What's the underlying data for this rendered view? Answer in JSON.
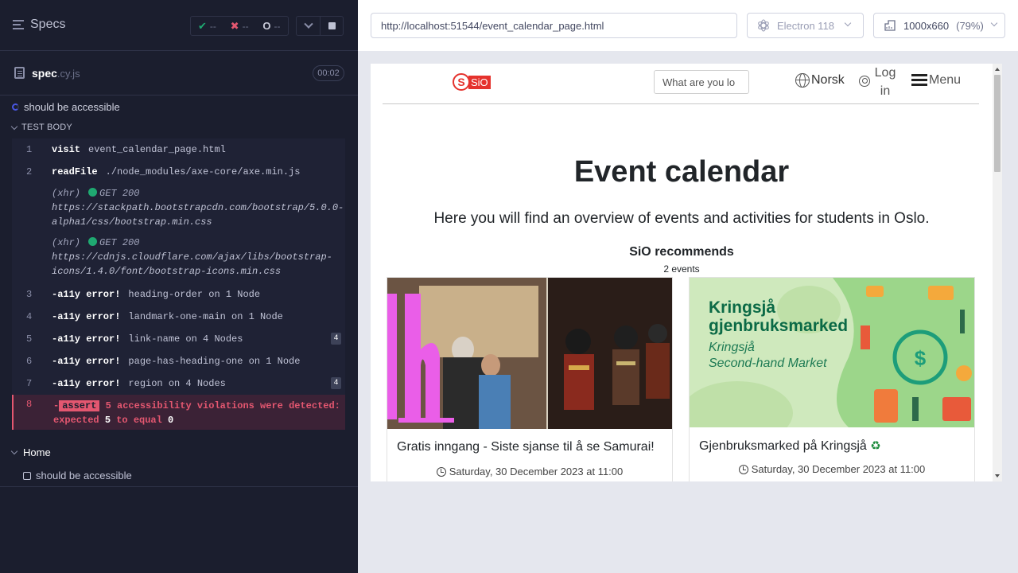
{
  "reporter": {
    "specs_label": "Specs",
    "stats": {
      "passed": "--",
      "failed": "--",
      "pending": "--"
    },
    "spec": {
      "name": "spec",
      "ext": ".cy.js",
      "duration": "00:02"
    },
    "test_title": "should be accessible",
    "body_label": "TEST BODY",
    "commands": [
      {
        "num": "1",
        "name": "visit",
        "msg": "event_calendar_page.html"
      },
      {
        "num": "2",
        "name": "readFile",
        "msg": "./node_modules/axe-core/axe.min.js"
      }
    ],
    "xhr": [
      {
        "label": "(xhr)",
        "status": "GET 200",
        "url_line1": "https://stackpath.bootstrapcdn.com/bootstrap/5.0.0-",
        "url_line2": "alpha1/css/bootstrap.min.css"
      },
      {
        "label": "(xhr)",
        "status": "GET 200",
        "url_line1": "https://cdnjs.cloudflare.com/ajax/libs/bootstrap-",
        "url_line2": "icons/1.4.0/font/bootstrap-icons.min.css"
      }
    ],
    "a11y": [
      {
        "num": "3",
        "name": "-a11y error!",
        "msg": "heading-order on 1 Node",
        "badge": ""
      },
      {
        "num": "4",
        "name": "-a11y error!",
        "msg": "landmark-one-main on 1 Node",
        "badge": ""
      },
      {
        "num": "5",
        "name": "-a11y error!",
        "msg": "link-name on 4 Nodes",
        "badge": "4"
      },
      {
        "num": "6",
        "name": "-a11y error!",
        "msg": "page-has-heading-one on 1 Node",
        "badge": ""
      },
      {
        "num": "7",
        "name": "-a11y error!",
        "msg": "region on 4 Nodes",
        "badge": "4"
      }
    ],
    "assert": {
      "num": "8",
      "prefix": "-",
      "tag": "assert",
      "line1": "5 accessibility violations were detected:",
      "line2_a": "expected",
      "line2_b": "5",
      "line2_c": "to equal",
      "line2_d": "0"
    },
    "suite": {
      "name": "Home",
      "test": "should be accessible"
    }
  },
  "aut": {
    "url": "http://localhost:51544/event_calendar_page.html",
    "browser": "Electron 118",
    "viewport": "1000x660",
    "zoom": "(79%)"
  },
  "site": {
    "logo_letter": "S",
    "logo_text": "SiO",
    "search_placeholder": "What are you lo",
    "language": "Norsk",
    "login": "Log in",
    "menu": "Menu",
    "title": "Event calendar",
    "lead": "Here you will find an overview of events and activities for students in Oslo.",
    "recommends": "SiO recommends",
    "events_count": "2 events",
    "cards": [
      {
        "title": "Gratis inngang - Siste sjanse til å se Samurai!",
        "date": "Saturday, 30 December 2023 at 11:00"
      },
      {
        "title": "Gjenbruksmarked på Kringsjå",
        "title_icon": "♻",
        "date": "Saturday, 30 December 2023 at 11:00",
        "img_title1": "Kringsjå",
        "img_title2": "gjenbruksmarked",
        "img_sub1": "Kringsjå",
        "img_sub2": "Second-hand Market"
      }
    ]
  },
  "colors": {
    "accent_fail": "#e45770",
    "accent_pass": "#1fa971",
    "brand": "#e5322d",
    "green_title": "#0b6a46"
  }
}
